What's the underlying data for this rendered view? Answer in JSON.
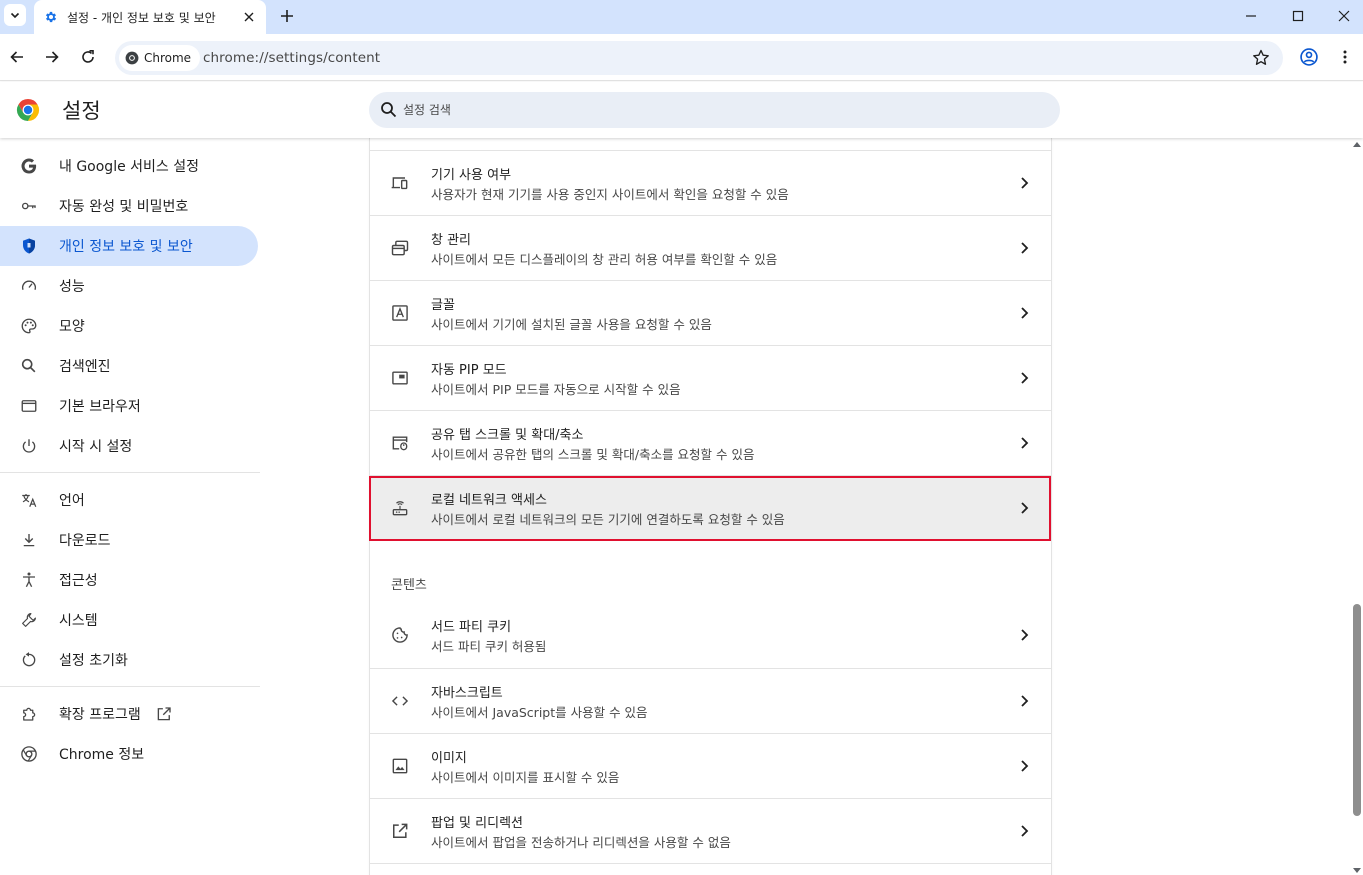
{
  "browser": {
    "tab": {
      "title": "설정 - 개인 정보 보호 및 보안",
      "icon": "gear-icon"
    },
    "omnibox": {
      "chip_label": "Chrome",
      "url": "chrome://settings/content"
    }
  },
  "header": {
    "title": "설정",
    "search_placeholder": "설정 검색"
  },
  "sidebar": {
    "items": [
      {
        "label": "내 Google 서비스 설정",
        "icon": "google-g-icon"
      },
      {
        "label": "자동 완성 및 비밀번호",
        "icon": "key-icon"
      },
      {
        "label": "개인 정보 보호 및 보안",
        "icon": "shield-icon",
        "active": true
      },
      {
        "label": "성능",
        "icon": "speedometer-icon"
      },
      {
        "label": "모양",
        "icon": "palette-icon"
      },
      {
        "label": "검색엔진",
        "icon": "search-icon"
      },
      {
        "label": "기본 브라우저",
        "icon": "browser-window-icon"
      },
      {
        "label": "시작 시 설정",
        "icon": "power-icon"
      },
      {
        "label": "언어",
        "icon": "translate-icon"
      },
      {
        "label": "다운로드",
        "icon": "download-icon"
      },
      {
        "label": "접근성",
        "icon": "accessibility-icon"
      },
      {
        "label": "시스템",
        "icon": "wrench-icon"
      },
      {
        "label": "설정 초기화",
        "icon": "reset-icon"
      },
      {
        "label": "확장 프로그램",
        "icon": "puzzle-icon"
      },
      {
        "label": "Chrome 정보",
        "icon": "chrome-logo-icon"
      }
    ]
  },
  "content": {
    "rows": [
      {
        "title": "기기 사용 여부",
        "subtitle": "사용자가 현재 기기를 사용 중인지 사이트에서 확인을 요청할 수 있음",
        "icon": "devices-icon"
      },
      {
        "title": "창 관리",
        "subtitle": "사이트에서 모든 디스플레이의 창 관리 허용 여부를 확인할 수 있음",
        "icon": "window-management-icon"
      },
      {
        "title": "글꼴",
        "subtitle": "사이트에서 기기에 설치된 글꼴 사용을 요청할 수 있음",
        "icon": "font-icon"
      },
      {
        "title": "자동 PIP 모드",
        "subtitle": "사이트에서 PIP 모드를 자동으로 시작할 수 있음",
        "icon": "picture-in-picture-icon"
      },
      {
        "title": "공유 탭 스크롤 및 확대/축소",
        "subtitle": "사이트에서 공유한 탭의 스크롤 및 확대/축소를 요청할 수 있음",
        "icon": "shared-tab-icon"
      },
      {
        "title": "로컬 네트워크 액세스",
        "subtitle": "사이트에서 로컬 네트워크의 모든 기기에 연결하도록 요청할 수 있음",
        "icon": "router-icon",
        "highlighted": true
      }
    ],
    "section_label": "콘텐츠",
    "content_rows": [
      {
        "title": "서드 파티 쿠키",
        "subtitle": "서드 파티 쿠키 허용됨",
        "icon": "cookie-icon"
      },
      {
        "title": "자바스크립트",
        "subtitle": "사이트에서 JavaScript를 사용할 수 있음",
        "icon": "code-icon"
      },
      {
        "title": "이미지",
        "subtitle": "사이트에서 이미지를 표시할 수 있음",
        "icon": "image-icon"
      },
      {
        "title": "팝업 및 리디렉션",
        "subtitle": "사이트에서 팝업을 전송하거나 리디렉션을 사용할 수 없음",
        "icon": "open-in-new-icon"
      }
    ]
  },
  "colors": {
    "tabstrip_bg": "#d3e3fd",
    "active_nav_bg": "#d3e3fd",
    "active_nav_text": "#0b57d0",
    "highlight_border": "#e0102f",
    "highlight_row_bg": "#ededed"
  }
}
